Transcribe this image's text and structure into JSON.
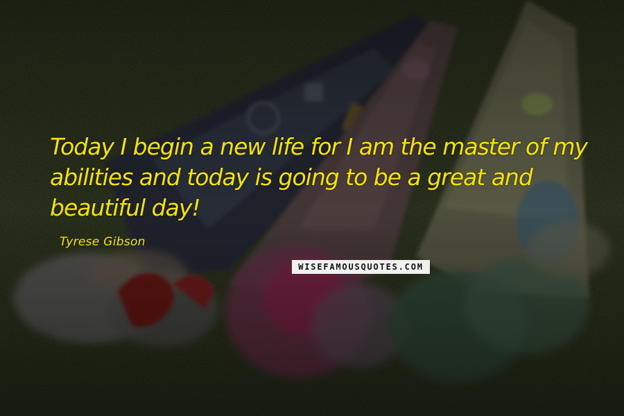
{
  "quote": {
    "text": "Today I begin a new life for I am the master of my abilities and today is going to be a great and beautiful day!",
    "author": "Tyrese Gibson"
  },
  "watermark": "WISEFAMOUSQUOTES.COM",
  "colors": {
    "text": "#f5e400",
    "background": "#15180f"
  }
}
